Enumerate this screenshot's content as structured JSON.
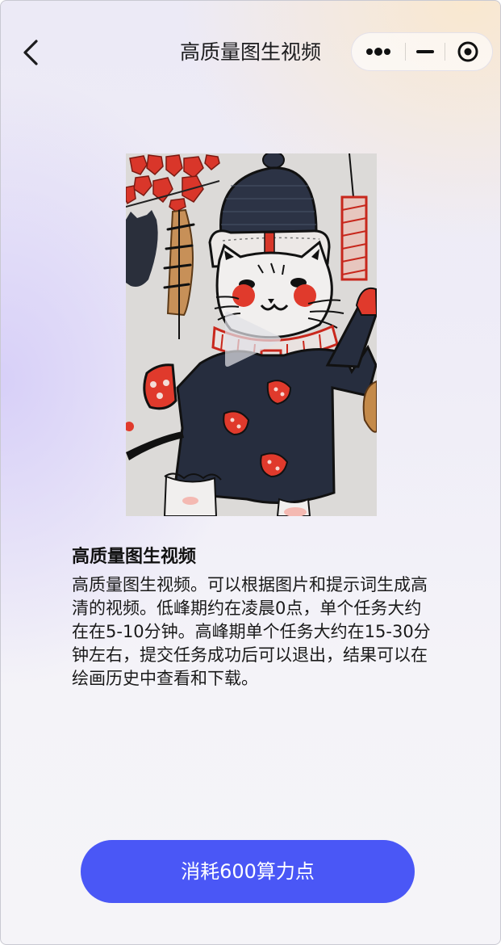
{
  "nav": {
    "title": "高质量图生视频"
  },
  "feature": {
    "title": "高质量图生视频",
    "description": "高质量图生视频。可以根据图片和提示词生成高清的视频。低峰期约在凌晨0点，单个任务大约在在5-10分钟。高峰期单个任务大约在15-30分钟左右，提交任务成功后可以退出，结果可以在绘画历史中查看和下载。"
  },
  "action": {
    "button_label": "消耗600算力点"
  },
  "colors": {
    "accent": "#4a57f6",
    "title_text": "#1c1c1e"
  },
  "icons": {
    "back": "chevron-left-icon",
    "more": "more-dots-icon",
    "minimize": "minimize-icon",
    "close": "target-close-icon",
    "play": "play-icon"
  }
}
